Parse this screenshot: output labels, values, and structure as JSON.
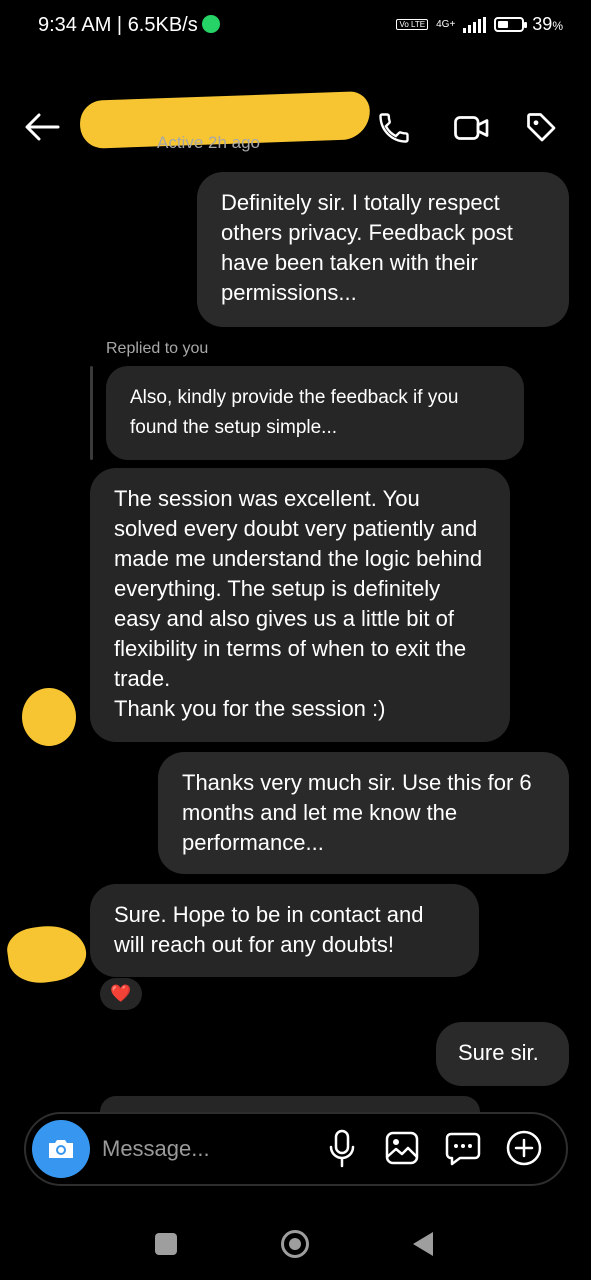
{
  "status_bar": {
    "time_speed": "9:34 AM | 6.5KB/s",
    "volte": "Vo LTE",
    "network": "4G+",
    "battery": "39",
    "battery_unit": "%"
  },
  "header": {
    "status": "Active 2h ago",
    "back_icon": "arrow-left-icon",
    "call_icon": "phone-icon",
    "video_icon": "video-camera-icon",
    "tag_icon": "tag-icon"
  },
  "messages": [
    {
      "direction": "outgoing",
      "text": "Definitely sir. I totally respect others privacy. Feedback post have been taken with their permissions..."
    },
    {
      "direction": "incoming",
      "reply_label": "Replied to you",
      "quoted_text": "Also, kindly provide the feedback if you found the setup simple...",
      "text": "The session was excellent. You solved every doubt very patiently and made me understand the logic behind everything. The setup is definitely easy and also gives us a little bit of flexibility in terms of when to exit the trade.\nThank you for the session :)"
    },
    {
      "direction": "outgoing",
      "text": "Thanks very much sir. Use this for 6 months and let me know the performance..."
    },
    {
      "direction": "incoming",
      "text": "Sure. Hope to be in contact and will reach out for any doubts!",
      "reaction": "❤️"
    },
    {
      "direction": "outgoing",
      "text": "Sure sir."
    }
  ],
  "composer": {
    "placeholder": "Message...",
    "icons": [
      "camera-icon",
      "microphone-icon",
      "gallery-icon",
      "sticker-icon",
      "plus-icon"
    ]
  },
  "colors": {
    "accent": "#3797f0",
    "bubble": "#262626",
    "redaction": "#f7c531",
    "whatsapp": "#25d366"
  }
}
